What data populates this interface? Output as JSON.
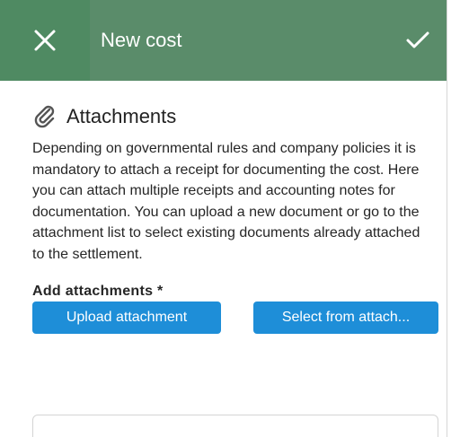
{
  "header": {
    "title": "New cost"
  },
  "attachments": {
    "heading": "Attachments",
    "description": "Depending on governmental rules and company policies it is mandatory to attach a receipt for documenting the cost. Here you can attach multiple receipts and accounting notes for documentation. You can upload a new document or go to the attachment list to select existing documents already attached to the settlement.",
    "add_label": "Add attachments *",
    "upload_button": "Upload attachment",
    "select_button": "Select from attach..."
  },
  "icons": {
    "close": "close-icon",
    "confirm": "check-icon",
    "attachments": "paperclip-icon"
  },
  "colors": {
    "header_bg": "#5a8c6a",
    "close_bg": "#4f8a62",
    "button_bg": "#1e8ed8"
  }
}
